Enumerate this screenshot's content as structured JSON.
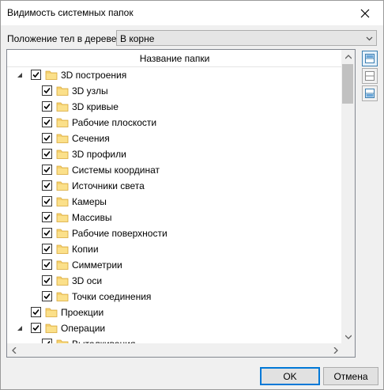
{
  "window": {
    "title": "Видимость системных папок",
    "close_icon": "close-icon"
  },
  "position": {
    "label": "Положение тел в дереве:",
    "value": "В корне"
  },
  "tree": {
    "column_header": "Название папки",
    "items": [
      {
        "label": "3D построения",
        "level": 0,
        "expanded": true,
        "checked": true
      },
      {
        "label": "3D узлы",
        "level": 1,
        "checked": true
      },
      {
        "label": "3D кривые",
        "level": 1,
        "checked": true
      },
      {
        "label": "Рабочие плоскости",
        "level": 1,
        "checked": true
      },
      {
        "label": "Сечения",
        "level": 1,
        "checked": true
      },
      {
        "label": "3D профили",
        "level": 1,
        "checked": true
      },
      {
        "label": "Системы координат",
        "level": 1,
        "checked": true
      },
      {
        "label": "Источники света",
        "level": 1,
        "checked": true
      },
      {
        "label": "Камеры",
        "level": 1,
        "checked": true
      },
      {
        "label": "Массивы",
        "level": 1,
        "checked": true
      },
      {
        "label": "Рабочие поверхности",
        "level": 1,
        "checked": true
      },
      {
        "label": "Копии",
        "level": 1,
        "checked": true
      },
      {
        "label": "Симметрии",
        "level": 1,
        "checked": true
      },
      {
        "label": "3D оси",
        "level": 1,
        "checked": true
      },
      {
        "label": "Точки соединения",
        "level": 1,
        "checked": true
      },
      {
        "label": "Проекции",
        "level": 0,
        "expanded": false,
        "checked": true
      },
      {
        "label": "Операции",
        "level": 0,
        "expanded": true,
        "checked": true
      },
      {
        "label": "Выталкивания",
        "level": 1,
        "checked": true
      }
    ]
  },
  "buttons": {
    "ok": "OK",
    "cancel": "Отмена"
  },
  "colors": {
    "folder": "#f5d06f",
    "accent": "#0078d7"
  }
}
